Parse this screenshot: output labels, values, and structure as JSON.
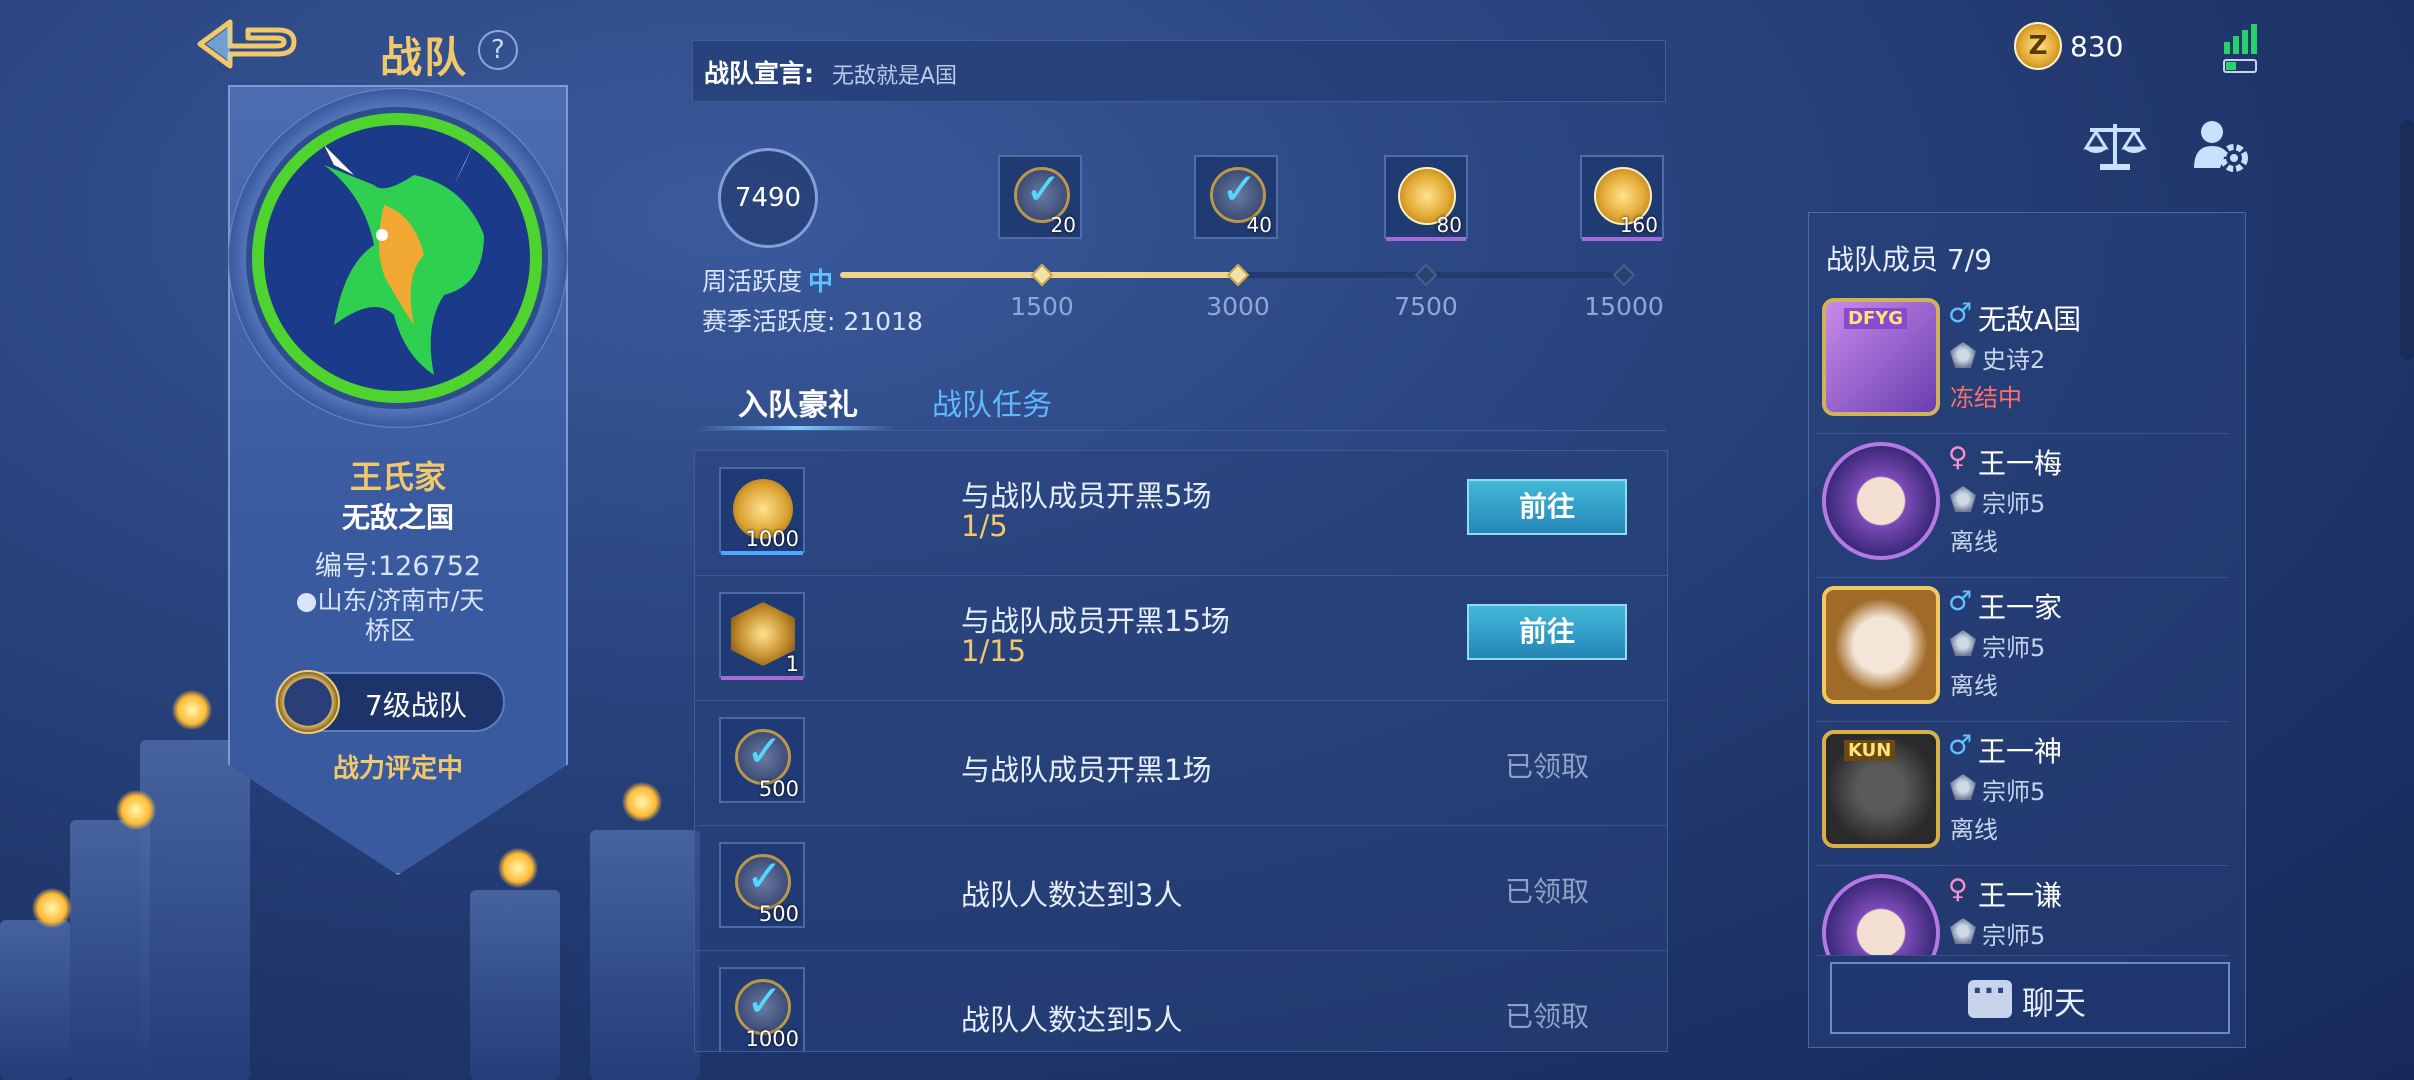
{
  "header": {
    "title": "战队",
    "help_icon": "question-icon",
    "back_icon": "back-arrow-icon"
  },
  "team": {
    "name": "王氏家",
    "subname": "无敌之国",
    "id_label": "编号:126752",
    "location_line1": "山东/济南市/天",
    "location_line2": "桥区",
    "level": "7级战队",
    "power": "战力评定中"
  },
  "declaration": {
    "label": "战队宣言:",
    "text": "无敌就是A国"
  },
  "activity": {
    "current": "7490",
    "weekly_label": "周活跃度",
    "weekly_level": "中",
    "season_label": "赛季活跃度: 21018",
    "progress_fraction": 0.5,
    "milestones": [
      {
        "label": "1500",
        "reward": "20",
        "claimed": true
      },
      {
        "label": "3000",
        "reward": "40",
        "claimed": true
      },
      {
        "label": "7500",
        "reward": "80",
        "claimed": false
      },
      {
        "label": "15000",
        "reward": "160",
        "claimed": false
      }
    ]
  },
  "tabs": [
    {
      "label": "入队豪礼",
      "active": true
    },
    {
      "label": "战队任务",
      "active": false
    }
  ],
  "tasks": [
    {
      "name": "与战队成员开黑5场",
      "progress": "1/5",
      "reward_qty": "1000",
      "action": "前往",
      "status": "go"
    },
    {
      "name": "与战队成员开黑15场",
      "progress": "1/15",
      "reward_qty": "1",
      "action": "前往",
      "status": "go"
    },
    {
      "name": "与战队成员开黑1场",
      "progress": "",
      "reward_qty": "500",
      "action": "已领取",
      "status": "claimed"
    },
    {
      "name": "战队人数达到3人",
      "progress": "",
      "reward_qty": "500",
      "action": "已领取",
      "status": "claimed"
    },
    {
      "name": "战队人数达到5人",
      "progress": "",
      "reward_qty": "1000",
      "action": "已领取",
      "status": "claimed"
    }
  ],
  "topbar": {
    "coins": "830",
    "coin_icon": "z-coin-icon"
  },
  "members": {
    "title": "战队成员 7/9",
    "list": [
      {
        "gender": "♂",
        "name": "无敌A国",
        "rank": "史诗2",
        "status": "冻结中",
        "avatar_tag": "DFYG"
      },
      {
        "gender": "♀",
        "name": "王一梅",
        "rank": "宗师5",
        "status": "离线",
        "avatar_tag": ""
      },
      {
        "gender": "♂",
        "name": "王一家",
        "rank": "宗师5",
        "status": "离线",
        "avatar_tag": ""
      },
      {
        "gender": "♂",
        "name": "王一神",
        "rank": "宗师5",
        "status": "离线",
        "avatar_tag": "KUN"
      },
      {
        "gender": "♀",
        "name": "王一谦",
        "rank": "宗师5",
        "status": "",
        "avatar_tag": ""
      }
    ]
  },
  "chat": {
    "label": "聊天"
  },
  "colors": {
    "accent_gold": "#f1c86a",
    "accent_blue": "#5fc3ff",
    "frozen_red": "#ff6e6e",
    "emblem_green": "#4fd32e"
  }
}
